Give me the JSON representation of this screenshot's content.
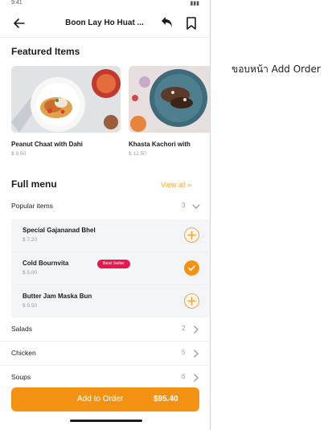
{
  "status_bar": {
    "left": "9:41",
    "right": "▮▮▮"
  },
  "header": {
    "title": "Boon Lay Ho Huat ..."
  },
  "featured": {
    "heading": "Featured Items",
    "items": [
      {
        "name": "Peanut Chaat with Dahi",
        "price": "$ 9.50"
      },
      {
        "name": "Khasta Kachori with",
        "price": "$ 12.50"
      }
    ]
  },
  "full_menu": {
    "heading": "Full menu",
    "view_all": "View all »",
    "categories": [
      {
        "label": "Popular items",
        "count": "3"
      },
      {
        "label": "Salads",
        "count": "2"
      },
      {
        "label": "Chicken",
        "count": "5"
      },
      {
        "label": "Soups",
        "count": "6"
      }
    ],
    "popular_items": [
      {
        "name": "Special Gajananad Bhel",
        "price": "$ 7.20",
        "state": "add"
      },
      {
        "name": "Cold Bournvita",
        "price": "$ 5.00",
        "badge": "Best Seller",
        "state": "added"
      },
      {
        "name": "Butter Jam Maska Bun",
        "price": "$ 9.50",
        "state": "add"
      }
    ]
  },
  "order_button": {
    "label": "Add to Order",
    "price": "$95.40"
  },
  "annotation": "ขอบหน้า Add Order",
  "colors": {
    "accent": "#f39212",
    "badge": "#e8174f",
    "row_bg": "#f4f5f9"
  }
}
